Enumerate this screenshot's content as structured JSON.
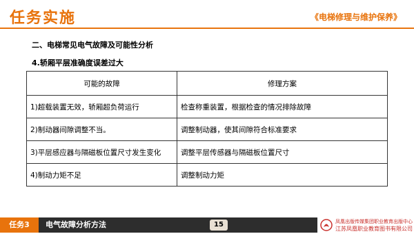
{
  "header": {
    "title": "任务实施",
    "book": "《电梯修理与维护保养》"
  },
  "content": {
    "section_heading": "二、电梯常见电气故障及可能性分析",
    "sub_heading": "4.轿厢平层准确度误差过大"
  },
  "table": {
    "columns": [
      "可能的故障",
      "修理方案"
    ],
    "rows": [
      [
        "1)超载装置无效，轿厢超负荷运行",
        "检查称重装置，根据检查的情况排除故障"
      ],
      [
        "2)制动器间隙调整不当。",
        "调整制动器，使其间隙符合标准要求"
      ],
      [
        "3)平层感应器与隔磁板位置尺寸发生变化",
        "调整平层传感器与隔磁板位置尺寸"
      ],
      [
        "4)制动力矩不足",
        "调整制动力矩"
      ]
    ]
  },
  "footer": {
    "task_label": "任务3",
    "title": "电气故障分析方法",
    "page": "15",
    "publisher_line1": "凤凰出版传媒集团职业教育出版中心",
    "publisher_line2": "江苏凤凰职业教育图书有限公司"
  },
  "colors": {
    "accent": "#e8730c",
    "footer_bg": "#2d2d2d"
  }
}
